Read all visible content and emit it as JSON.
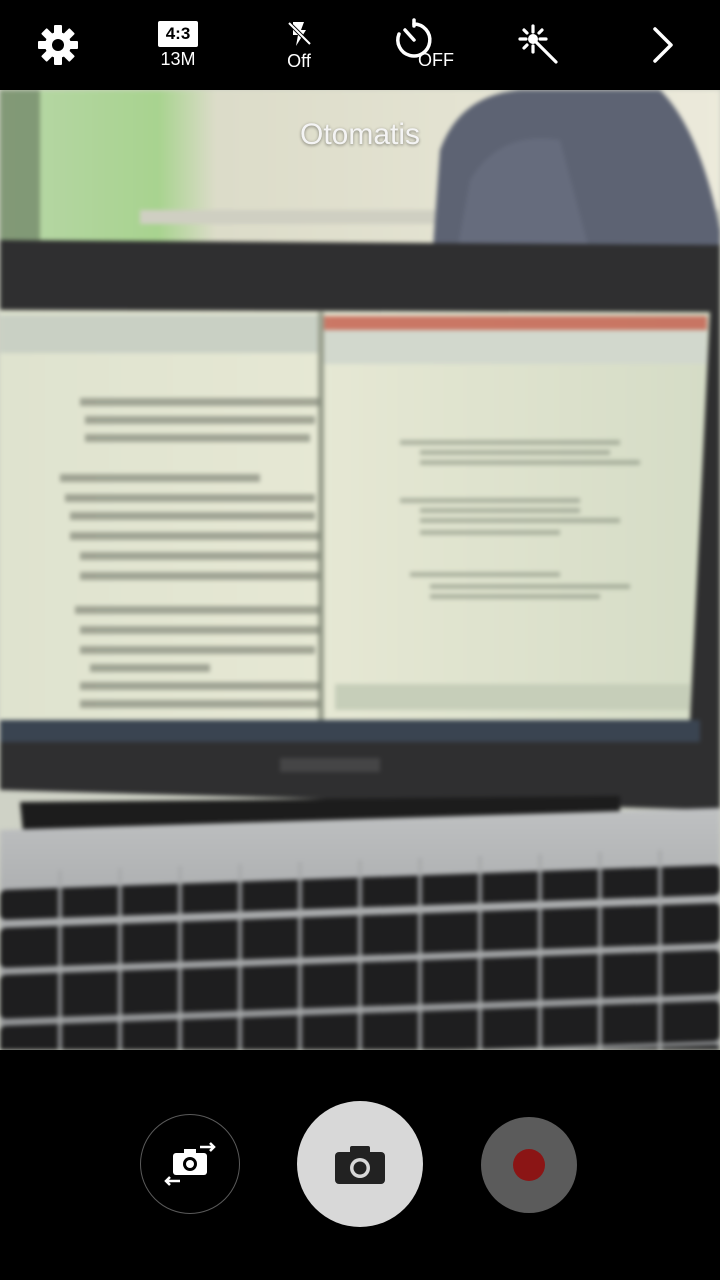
{
  "toolbar": {
    "settings_icon": "gear-icon",
    "ratio_label": "4:3",
    "resolution_label": "13M",
    "flash_icon": "flash-off-icon",
    "flash_label": "Off",
    "timer_icon": "timer-icon",
    "timer_label": "OFF",
    "effects_icon": "magic-wand-icon",
    "more_icon": "chevron-right-icon"
  },
  "viewfinder": {
    "mode_label": "Otomatis"
  },
  "controls": {
    "switch_camera_icon": "switch-camera-icon",
    "shutter_icon": "camera-icon",
    "record_icon": "record-icon",
    "record_color": "#8b1515"
  }
}
